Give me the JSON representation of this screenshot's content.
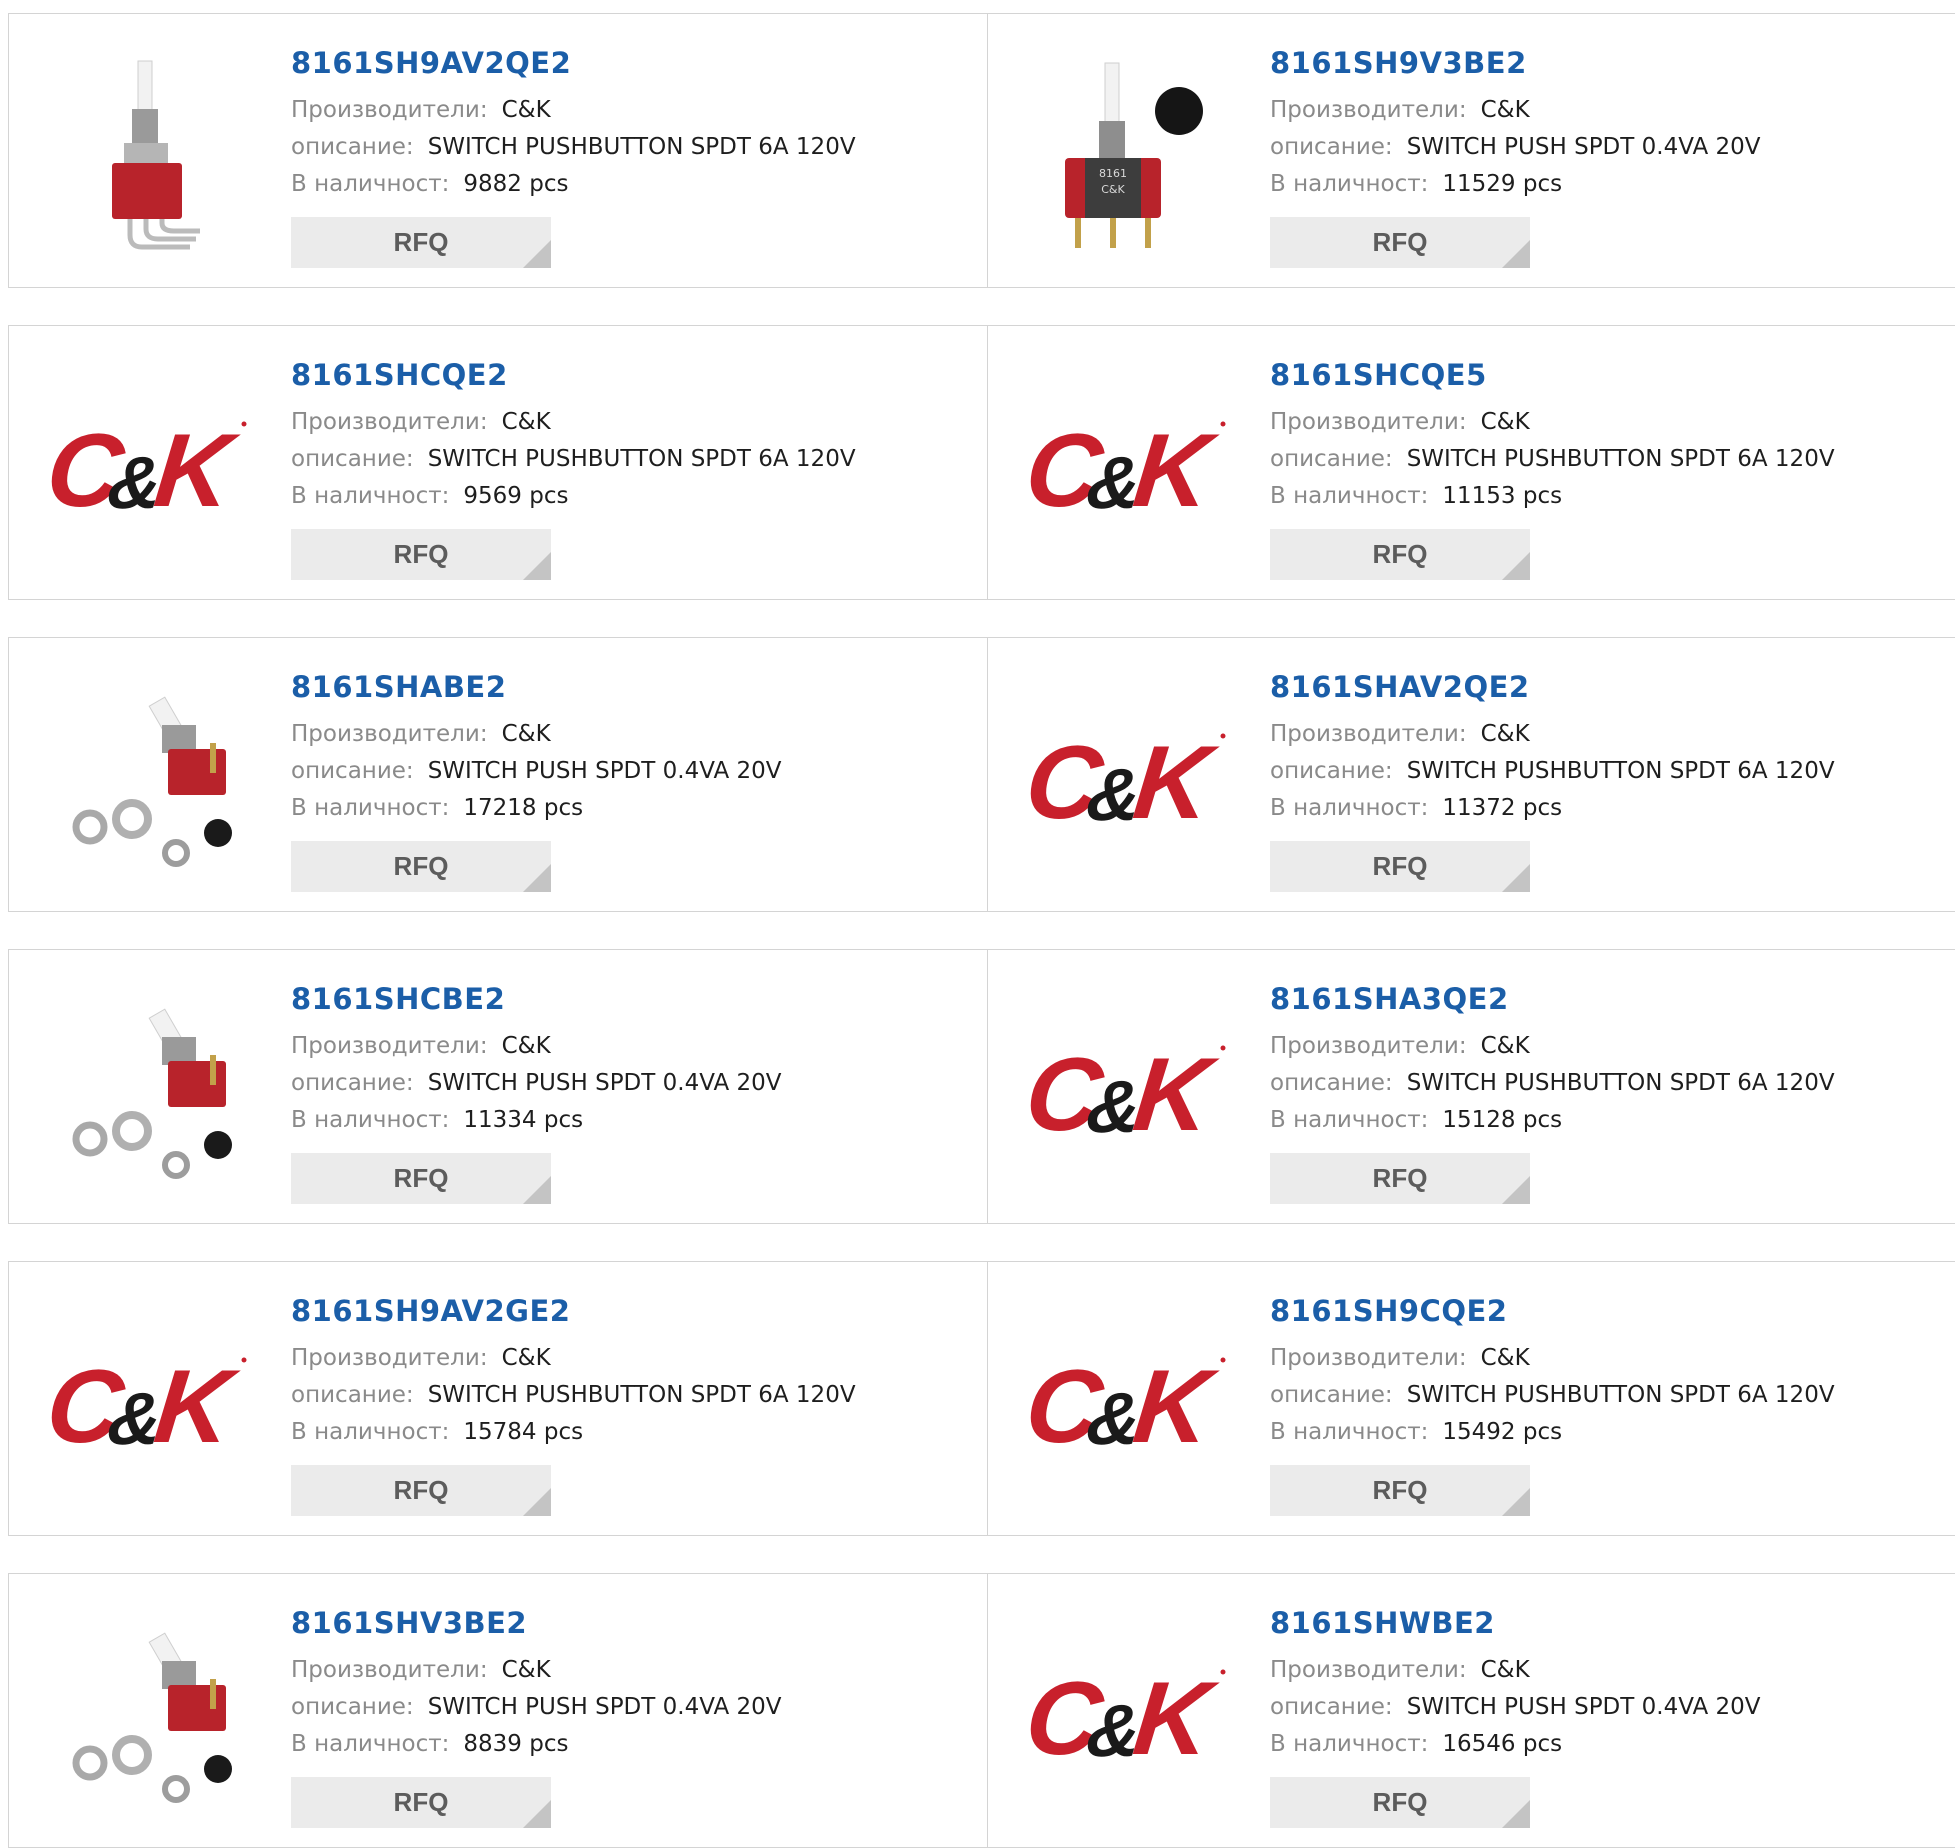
{
  "labels": {
    "manufacturer": "Производители:",
    "description": "описание:",
    "stock": "В наличност:",
    "rfq": "RFQ"
  },
  "logo_text": "C&K",
  "products": [
    {
      "part": "8161SH9AV2QE2",
      "manufacturer": "C&K",
      "description": "SWITCH PUSHBUTTON SPDT 6A 120V",
      "stock": "9882 pcs",
      "image": "pushbutton-right-angle-photo"
    },
    {
      "part": "8161SH9V3BE2",
      "manufacturer": "C&K",
      "description": "SWITCH PUSH SPDT 0.4VA 20V",
      "stock": "11529 pcs",
      "image": "pushbutton-black-cap-photo"
    },
    {
      "part": "8161SHCQE2",
      "manufacturer": "C&K",
      "description": "SWITCH PUSHBUTTON SPDT 6A 120V",
      "stock": "9569 pcs",
      "image": "ck-logo"
    },
    {
      "part": "8161SHCQE5",
      "manufacturer": "C&K",
      "description": "SWITCH PUSHBUTTON SPDT 6A 120V",
      "stock": "11153 pcs",
      "image": "ck-logo"
    },
    {
      "part": "8161SHABE2",
      "manufacturer": "C&K",
      "description": "SWITCH PUSH SPDT 0.4VA 20V",
      "stock": "17218 pcs",
      "image": "pushbutton-hardware-kit-photo"
    },
    {
      "part": "8161SHAV2QE2",
      "manufacturer": "C&K",
      "description": "SWITCH PUSHBUTTON SPDT 6A 120V",
      "stock": "11372 pcs",
      "image": "ck-logo"
    },
    {
      "part": "8161SHCBE2",
      "manufacturer": "C&K",
      "description": "SWITCH PUSH SPDT 0.4VA 20V",
      "stock": "11334 pcs",
      "image": "pushbutton-hardware-kit-photo"
    },
    {
      "part": "8161SHA3QE2",
      "manufacturer": "C&K",
      "description": "SWITCH PUSHBUTTON SPDT 6A 120V",
      "stock": "15128 pcs",
      "image": "ck-logo"
    },
    {
      "part": "8161SH9AV2GE2",
      "manufacturer": "C&K",
      "description": "SWITCH PUSHBUTTON SPDT 6A 120V",
      "stock": "15784 pcs",
      "image": "ck-logo"
    },
    {
      "part": "8161SH9CQE2",
      "manufacturer": "C&K",
      "description": "SWITCH PUSHBUTTON SPDT 6A 120V",
      "stock": "15492 pcs",
      "image": "ck-logo"
    },
    {
      "part": "8161SHV3BE2",
      "manufacturer": "C&K",
      "description": "SWITCH PUSH SPDT 0.4VA 20V",
      "stock": "8839 pcs",
      "image": "pushbutton-hardware-kit-photo"
    },
    {
      "part": "8161SHWBE2",
      "manufacturer": "C&K",
      "description": "SWITCH PUSH SPDT 0.4VA 20V",
      "stock": "16546 pcs",
      "image": "ck-logo"
    }
  ],
  "colors": {
    "part_link": "#1b5ea8",
    "label": "#8a8a8a",
    "value": "#1e1e1e",
    "rfq_bg": "#ebebeb",
    "logo_red": "#c8202c",
    "logo_black": "#1a1a1a"
  }
}
